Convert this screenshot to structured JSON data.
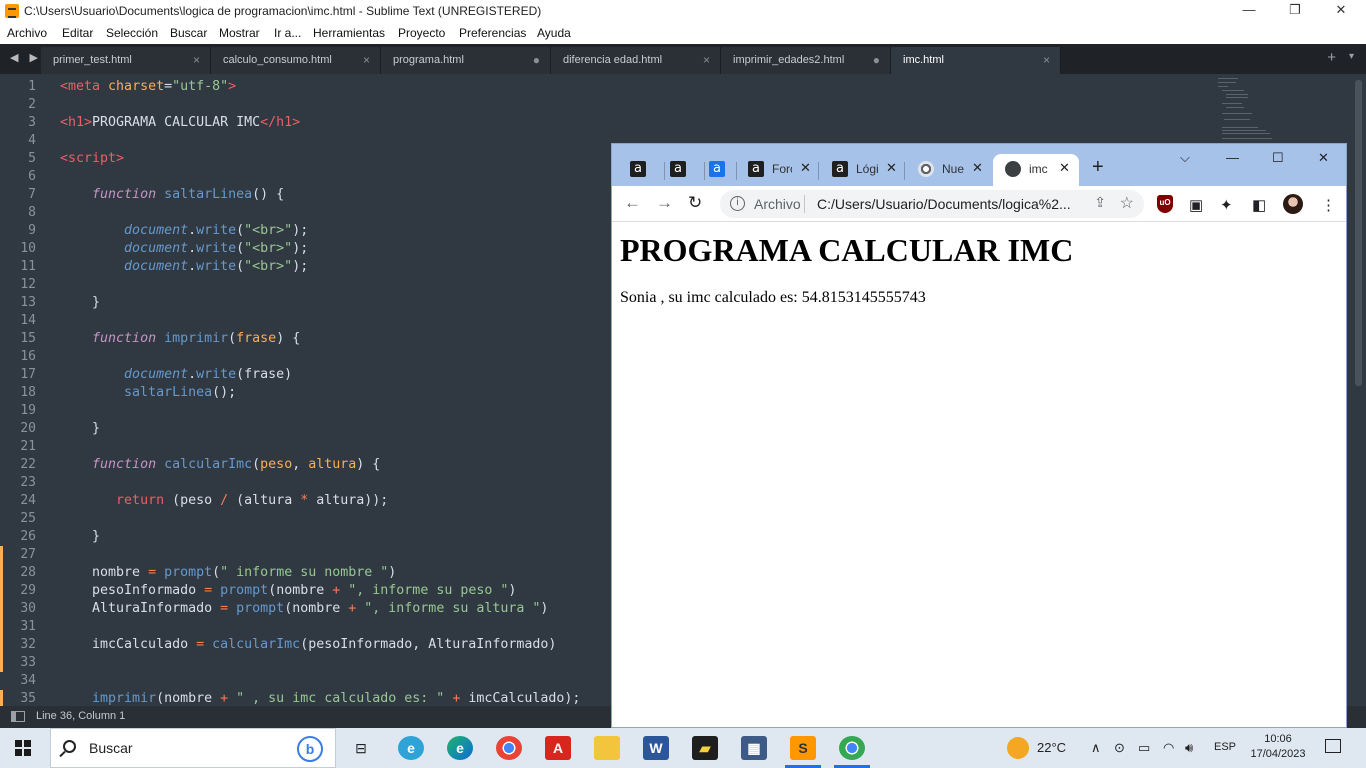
{
  "window": {
    "title": "C:\\Users\\Usuario\\Documents\\logica de programacion\\imc.html - Sublime Text (UNREGISTERED)",
    "controls": [
      "—",
      "❐",
      "✕"
    ]
  },
  "menu": [
    "Archivo",
    "Editar",
    "Selección",
    "Buscar",
    "Mostrar",
    "Ir a...",
    "Herramientas",
    "Proyecto",
    "Preferencias",
    "Ayuda"
  ],
  "editor_tabs": [
    {
      "label": "primer_test.html",
      "close": "×"
    },
    {
      "label": "calculo_consumo.html",
      "close": "×"
    },
    {
      "label": "programa.html",
      "close": "●"
    },
    {
      "label": "diferencia edad.html",
      "close": "×"
    },
    {
      "label": "imprimir_edades2.html",
      "close": "●"
    },
    {
      "label": "imc.html",
      "close": "×"
    }
  ],
  "editor_tab_bar": {
    "nav": "◀ ▶",
    "add": "+",
    "overflow": "▾"
  },
  "code_lines": [
    "1",
    "2",
    "3",
    "4",
    "5",
    "6",
    "7",
    "8",
    "9",
    "10",
    "11",
    "12",
    "13",
    "14",
    "15",
    "16",
    "17",
    "18",
    "19",
    "20",
    "21",
    "22",
    "23",
    "24",
    "25",
    "26",
    "27",
    "28",
    "29",
    "30",
    "31",
    "32",
    "33",
    "34",
    "35"
  ],
  "status_bar": {
    "position": "Line 36, Column 1"
  },
  "browser": {
    "tabs": [
      {
        "icon": "a",
        "label": ""
      },
      {
        "icon": "a",
        "label": ""
      },
      {
        "icon": "a",
        "label": ""
      },
      {
        "icon": "a",
        "label": "Foro"
      },
      {
        "icon": "a",
        "label": "Lógi"
      },
      {
        "icon": "chrome",
        "label": "Nue"
      },
      {
        "icon": "globe",
        "label": "imc"
      }
    ],
    "tab_close": "✕",
    "new_tab": "+",
    "window_controls": [
      "⌵",
      "—",
      "☐",
      "✕"
    ],
    "nav": {
      "back": "←",
      "forward": "→",
      "reload": "↻"
    },
    "address": {
      "info": "i",
      "scheme": "Archivo",
      "url": "C:/Users/Usuario/Documents/logica%2..."
    },
    "page": {
      "heading": "PROGRAMA CALCULAR IMC",
      "output": "Sonia , su imc calculado es: 54.8153145555743"
    }
  },
  "taskbar": {
    "search_label": "Buscar",
    "bing_label": "b",
    "weather": "22°C",
    "language": "ESP",
    "time": "10:06",
    "date": "17/04/2023"
  }
}
